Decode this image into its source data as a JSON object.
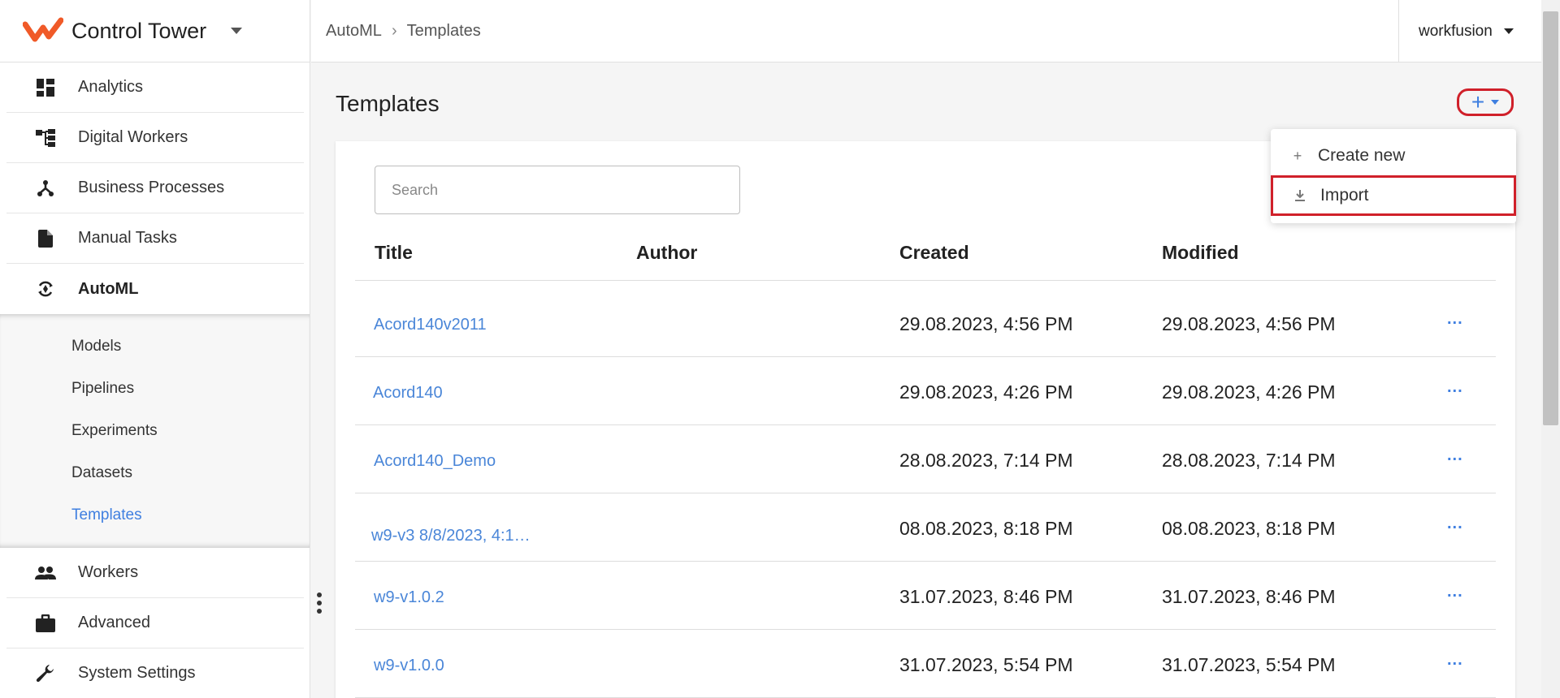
{
  "app": {
    "name": "Control Tower"
  },
  "breadcrumb": [
    "AutoML",
    "Templates"
  ],
  "user": {
    "name": "workfusion"
  },
  "sidebar": {
    "items": [
      {
        "label": "Analytics",
        "icon": "dashboard-icon"
      },
      {
        "label": "Digital Workers",
        "icon": "hierarchy-icon"
      },
      {
        "label": "Business Processes",
        "icon": "process-icon"
      },
      {
        "label": "Manual Tasks",
        "icon": "document-icon"
      },
      {
        "label": "AutoML",
        "icon": "automl-icon"
      }
    ],
    "sub_items": [
      "Models",
      "Pipelines",
      "Experiments",
      "Datasets",
      "Templates"
    ],
    "bottom_items": [
      {
        "label": "Workers",
        "icon": "people-icon"
      },
      {
        "label": "Advanced",
        "icon": "briefcase-icon"
      },
      {
        "label": "System Settings",
        "icon": "wrench-icon"
      }
    ]
  },
  "page": {
    "title": "Templates"
  },
  "search": {
    "placeholder": "Search"
  },
  "menu": {
    "create_new": "Create new",
    "import": "Import"
  },
  "table": {
    "columns": [
      "Title",
      "Author",
      "Created",
      "Modified"
    ],
    "more_label": "...",
    "rows": [
      {
        "title": "Acord140v2011",
        "author": "",
        "created": "29.08.2023, 4:56 PM",
        "modified": "29.08.2023, 4:56 PM"
      },
      {
        "title": "Acord140",
        "author": "",
        "created": "29.08.2023, 4:26 PM",
        "modified": "29.08.2023, 4:26 PM"
      },
      {
        "title": "Acord140_Demo",
        "author": "",
        "created": "28.08.2023, 7:14 PM",
        "modified": "28.08.2023, 7:14 PM"
      },
      {
        "title": "w9-v3 8/8/2023, 4:1…",
        "author": "",
        "created": "08.08.2023, 8:18 PM",
        "modified": "08.08.2023, 8:18 PM"
      },
      {
        "title": "w9-v1.0.2",
        "author": "",
        "created": "31.07.2023, 8:46 PM",
        "modified": "31.07.2023, 8:46 PM"
      },
      {
        "title": "w9-v1.0.0",
        "author": "",
        "created": "31.07.2023, 5:54 PM",
        "modified": "31.07.2023, 5:54 PM"
      }
    ]
  },
  "colors": {
    "accent": "#3f7fe0",
    "brand": "#f05a28",
    "highlight": "#d0202a"
  }
}
